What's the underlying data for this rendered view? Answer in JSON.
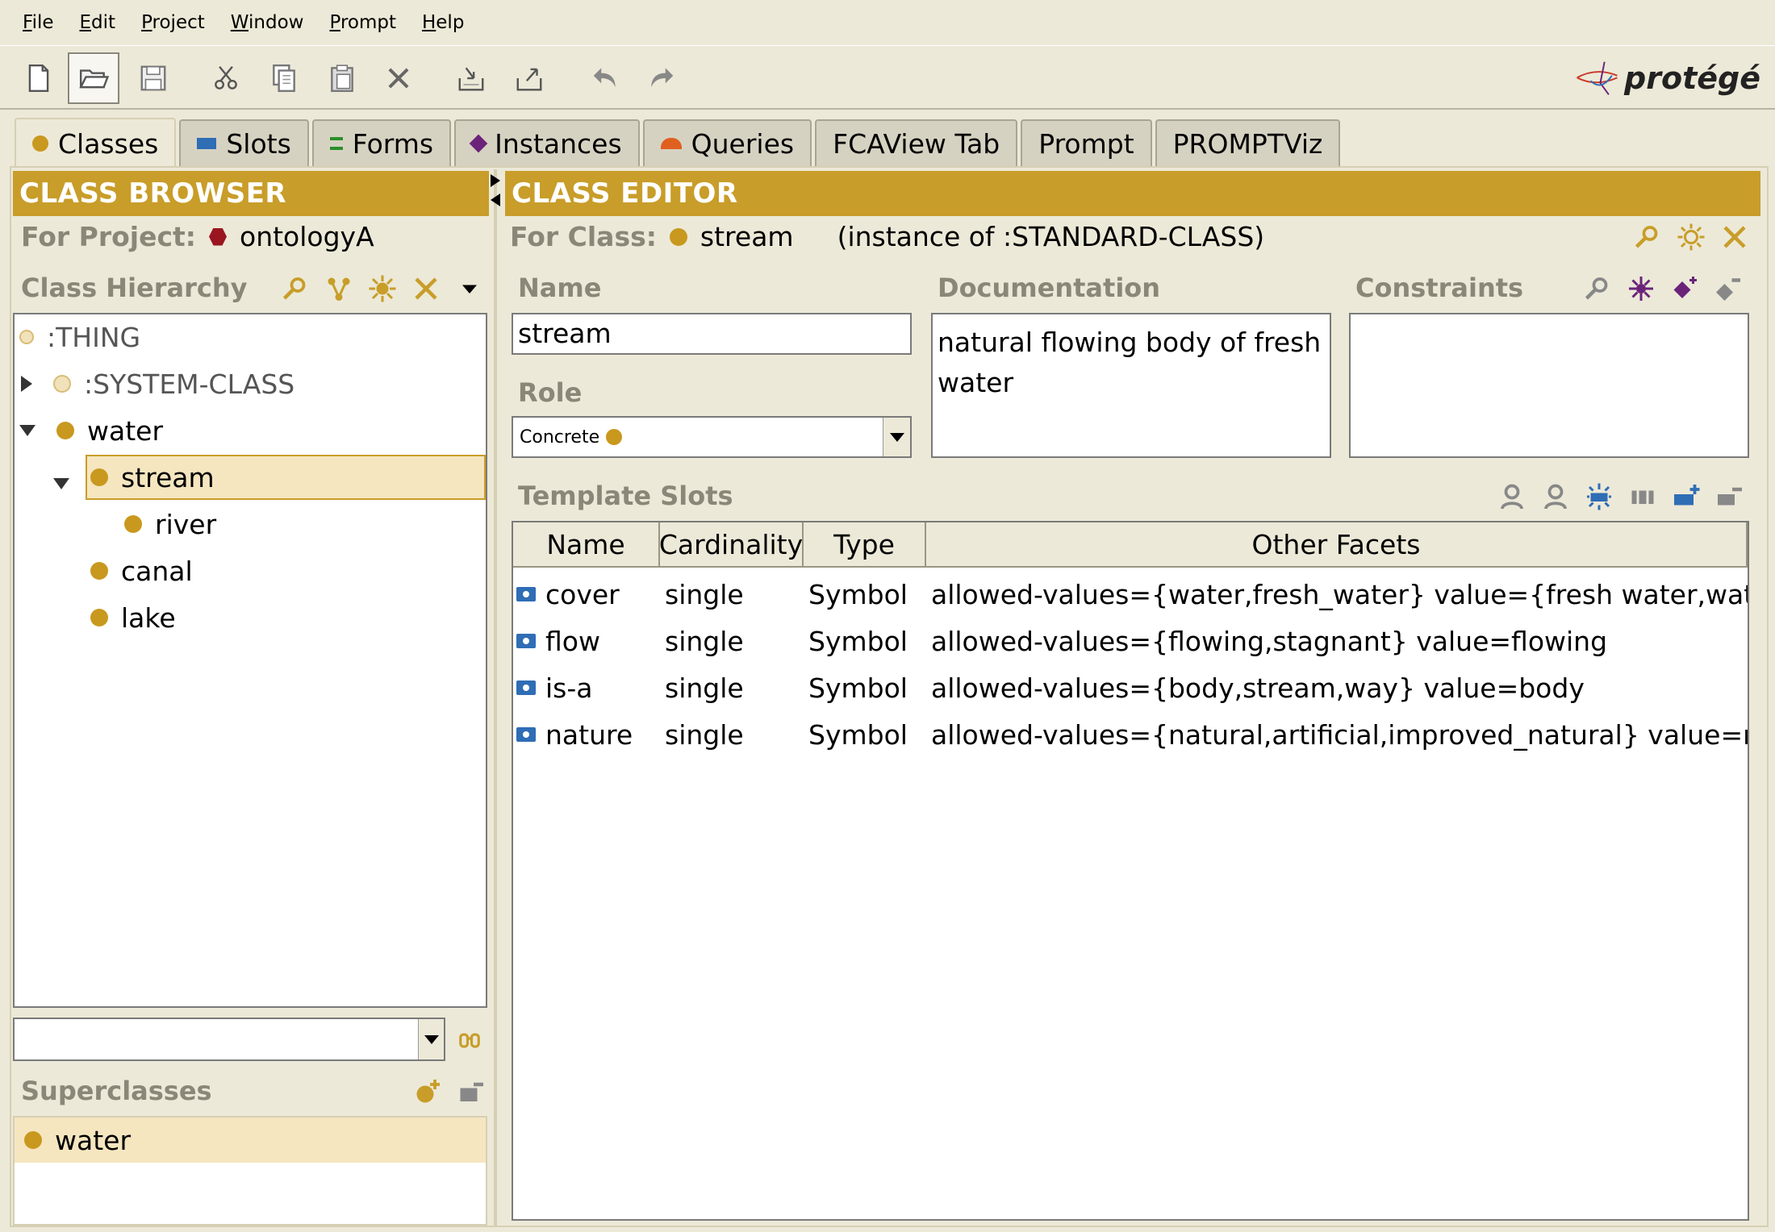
{
  "menu": [
    "File",
    "Edit",
    "Project",
    "Window",
    "Prompt",
    "Help"
  ],
  "logo_text": "protégé",
  "toolbar_icons": [
    "new-file-icon",
    "open-folder-icon",
    "save-icon",
    "cut-icon",
    "copy-icon",
    "paste-icon",
    "delete-icon",
    "import-icon",
    "export-icon",
    "undo-icon",
    "redo-icon"
  ],
  "tabs": [
    {
      "label": "Classes",
      "icon": "class-dot-icon",
      "active": true
    },
    {
      "label": "Slots",
      "icon": "slot-icon"
    },
    {
      "label": "Forms",
      "icon": "form-icon"
    },
    {
      "label": "Instances",
      "icon": "instance-icon"
    },
    {
      "label": "Queries",
      "icon": "query-icon"
    },
    {
      "label": "FCAView Tab"
    },
    {
      "label": "Prompt"
    },
    {
      "label": "PROMPTViz"
    }
  ],
  "browser": {
    "header": "CLASS BROWSER",
    "project_label": "For Project:",
    "project_name": "ontologyA",
    "hierarchy_label": "Class Hierarchy",
    "tree": [
      {
        "label": ":THING",
        "depth": 0,
        "toggle": "none",
        "dot": "hollow"
      },
      {
        "label": ":SYSTEM-CLASS",
        "depth": 0,
        "toggle": "collapsed",
        "dot": "hollow"
      },
      {
        "label": "water",
        "depth": 0,
        "toggle": "expanded",
        "dot": "solid"
      },
      {
        "label": "stream",
        "depth": 1,
        "toggle": "expanded",
        "dot": "solid",
        "selected": true
      },
      {
        "label": "river",
        "depth": 2,
        "toggle": "none",
        "dot": "solid"
      },
      {
        "label": "canal",
        "depth": 1,
        "toggle": "none",
        "dot": "solid"
      },
      {
        "label": "lake",
        "depth": 1,
        "toggle": "none",
        "dot": "solid"
      }
    ],
    "search_value": "",
    "superclasses_label": "Superclasses",
    "superclasses": [
      "water"
    ]
  },
  "editor": {
    "header": "CLASS EDITOR",
    "for_class_label": "For Class:",
    "class_name": "stream",
    "instance_of": "(instance of :STANDARD-CLASS)",
    "name_label": "Name",
    "name_value": "stream",
    "role_label": "Role",
    "role_value": "Concrete",
    "documentation_label": "Documentation",
    "documentation_value": "natural flowing body of fresh water",
    "constraints_label": "Constraints",
    "template_slots_label": "Template Slots",
    "columns": [
      "Name",
      "Cardinality",
      "Type",
      "Other Facets"
    ],
    "slots": [
      {
        "name": "cover",
        "cardinality": "single",
        "type": "Symbol",
        "facets": "allowed-values={water,fresh_water} value={fresh water,water}"
      },
      {
        "name": "flow",
        "cardinality": "single",
        "type": "Symbol",
        "facets": "allowed-values={flowing,stagnant} value=flowing"
      },
      {
        "name": "is-a",
        "cardinality": "single",
        "type": "Symbol",
        "facets": "allowed-values={body,stream,way} value=body"
      },
      {
        "name": "nature",
        "cardinality": "single",
        "type": "Symbol",
        "facets": "allowed-values={natural,artificial,improved_natural} value=natural"
      }
    ]
  },
  "colors": {
    "header_gold": "#c89d29",
    "selection": "#f5e6c0",
    "class_dot": "#c9981e"
  }
}
